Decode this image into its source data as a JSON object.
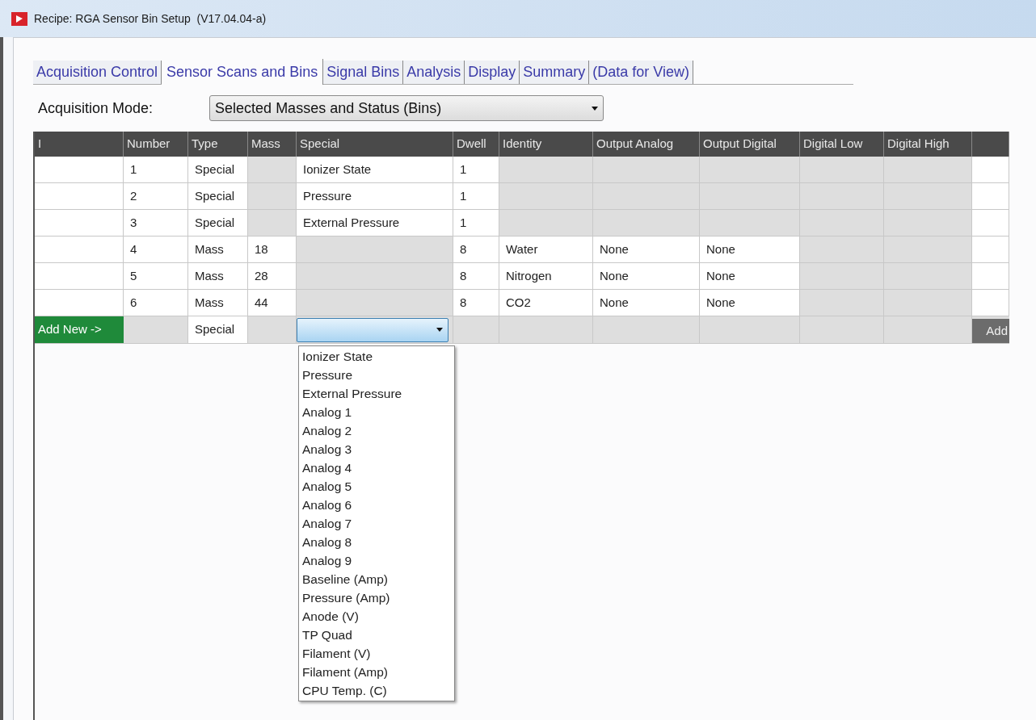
{
  "window": {
    "title": "Recipe: RGA Sensor Bin Setup  (V17.04.04-a)"
  },
  "tabs": [
    {
      "label": "Acquisition Control",
      "selected": false
    },
    {
      "label": "Sensor Scans and Bins",
      "selected": true
    },
    {
      "label": "Signal Bins",
      "selected": false
    },
    {
      "label": "Analysis",
      "selected": false
    },
    {
      "label": "Display",
      "selected": false
    },
    {
      "label": "Summary",
      "selected": false
    },
    {
      "label": "(Data for View)",
      "selected": false
    }
  ],
  "acquisition_mode": {
    "label": "Acquisition Mode:",
    "value": "Selected Masses and Status (Bins)"
  },
  "table": {
    "columns": [
      "I",
      "Number",
      "Type",
      "Mass",
      "Special",
      "Dwell",
      "Identity",
      "Output Analog",
      "Output Digital",
      "Digital Low",
      "Digital High",
      null
    ],
    "rows": [
      {
        "cells": [
          {
            "editable": true
          },
          {
            "text": "1",
            "editable": true
          },
          {
            "text": "Special",
            "editable": true
          },
          {
            "editable": false
          },
          {
            "text": "Ionizer State",
            "editable": true
          },
          {
            "text": "1",
            "editable": true
          },
          {
            "editable": false
          },
          {
            "editable": false
          },
          {
            "editable": false
          },
          {
            "editable": false
          },
          {
            "editable": false
          },
          {
            "editable": true
          }
        ]
      },
      {
        "cells": [
          {
            "editable": true
          },
          {
            "text": "2",
            "editable": true
          },
          {
            "text": "Special",
            "editable": true
          },
          {
            "editable": false
          },
          {
            "text": "Pressure",
            "editable": true
          },
          {
            "text": "1",
            "editable": true
          },
          {
            "editable": false
          },
          {
            "editable": false
          },
          {
            "editable": false
          },
          {
            "editable": false
          },
          {
            "editable": false
          },
          {
            "editable": true
          }
        ]
      },
      {
        "cells": [
          {
            "editable": true
          },
          {
            "text": "3",
            "editable": true
          },
          {
            "text": "Special",
            "editable": true
          },
          {
            "editable": false
          },
          {
            "text": "External Pressure",
            "editable": true
          },
          {
            "text": "1",
            "editable": true
          },
          {
            "editable": false
          },
          {
            "editable": false
          },
          {
            "editable": false
          },
          {
            "editable": false
          },
          {
            "editable": false
          },
          {
            "editable": true
          }
        ]
      },
      {
        "cells": [
          {
            "editable": true
          },
          {
            "text": "4",
            "editable": true
          },
          {
            "text": "Mass",
            "editable": true
          },
          {
            "text": "18",
            "editable": true
          },
          {
            "editable": false
          },
          {
            "text": "8",
            "editable": true
          },
          {
            "text": "Water",
            "editable": true
          },
          {
            "text": "None",
            "editable": true
          },
          {
            "text": "None",
            "editable": true
          },
          {
            "editable": false
          },
          {
            "editable": false
          },
          {
            "editable": true
          }
        ]
      },
      {
        "cells": [
          {
            "editable": true
          },
          {
            "text": "5",
            "editable": true
          },
          {
            "text": "Mass",
            "editable": true
          },
          {
            "text": "28",
            "editable": true
          },
          {
            "editable": false
          },
          {
            "text": "8",
            "editable": true
          },
          {
            "text": "Nitrogen",
            "editable": true
          },
          {
            "text": "None",
            "editable": true
          },
          {
            "text": "None",
            "editable": true
          },
          {
            "editable": false
          },
          {
            "editable": false
          },
          {
            "editable": true
          }
        ]
      },
      {
        "cells": [
          {
            "editable": true
          },
          {
            "text": "6",
            "editable": true
          },
          {
            "text": "Mass",
            "editable": true
          },
          {
            "text": "44",
            "editable": true
          },
          {
            "editable": false
          },
          {
            "text": "8",
            "editable": true
          },
          {
            "text": "CO2",
            "editable": true
          },
          {
            "text": "None",
            "editable": true
          },
          {
            "text": "None",
            "editable": true
          },
          {
            "editable": false
          },
          {
            "editable": false
          },
          {
            "editable": true
          }
        ]
      }
    ],
    "new_row": {
      "label": "Add New ->",
      "type": "Special",
      "add_button": "Add",
      "special_dropdown": {
        "expanded": true,
        "options": [
          "Ionizer State",
          "Pressure",
          "External Pressure",
          "Analog 1",
          "Analog 2",
          "Analog 3",
          "Analog 4",
          "Analog 5",
          "Analog 6",
          "Analog 7",
          "Analog 8",
          "Analog 9",
          "Baseline (Amp)",
          "Pressure (Amp)",
          "Anode (V)",
          "TP Quad",
          "Filament (V)",
          "Filament (Amp)",
          "CPU Temp. (C)"
        ]
      }
    }
  }
}
